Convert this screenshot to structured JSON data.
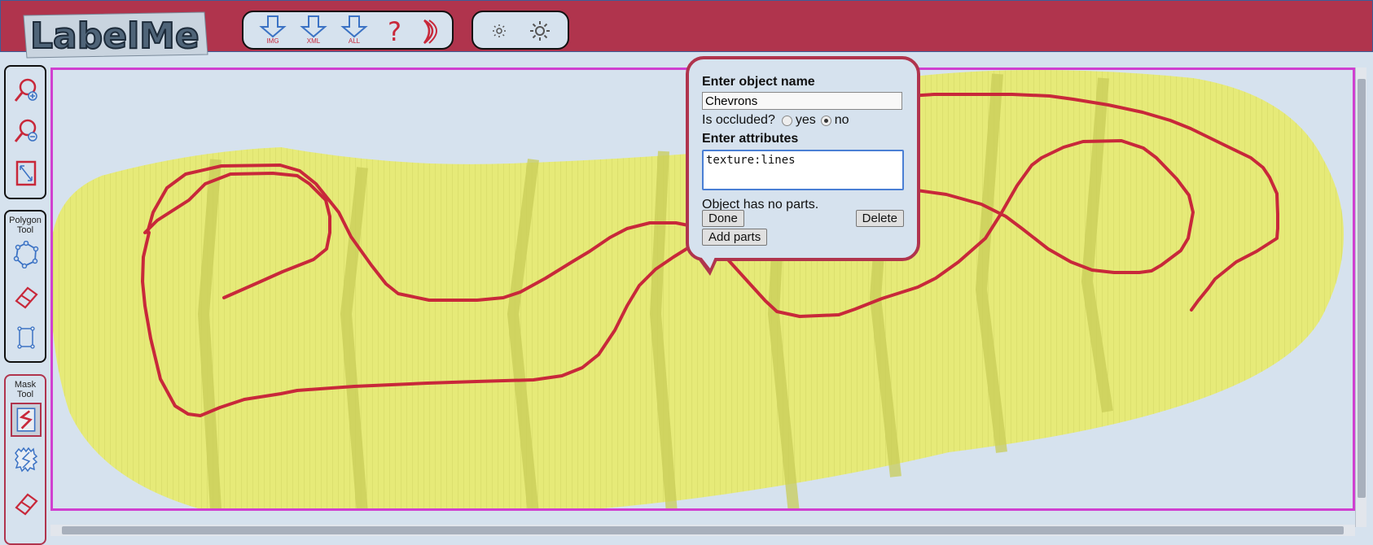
{
  "app": {
    "logo_text": "LabelMe"
  },
  "toolbar": {
    "download_image_label": "IMG",
    "download_xml_label": "XML",
    "download_all_label": "ALL",
    "help_icon": "question-mark",
    "next_image_icon": "crescent-arrow",
    "brightness_down_icon": "small-sun",
    "brightness_up_icon": "large-sun"
  },
  "sidebar": {
    "polygon_tool_label_1": "Polygon",
    "polygon_tool_label_2": "Tool",
    "mask_tool_label_1": "Mask",
    "mask_tool_label_2": "Tool"
  },
  "popup": {
    "name_title": "Enter object name",
    "name_value": "Chevrons",
    "occluded_question": "Is occluded?",
    "occluded_yes": "yes",
    "occluded_no": "no",
    "occluded_selected": "no",
    "attributes_title": "Enter attributes",
    "attributes_value": "texture:lines",
    "parts_text": "Object has no parts.",
    "done_label": "Done",
    "delete_label": "Delete",
    "add_parts_label": "Add parts"
  },
  "colors": {
    "brand": "#b0344d",
    "background": "#d6e2ee",
    "canvas_border": "#d040d0",
    "annotation_stroke": "#c8283a",
    "sole_fill": "#e6ea78"
  }
}
